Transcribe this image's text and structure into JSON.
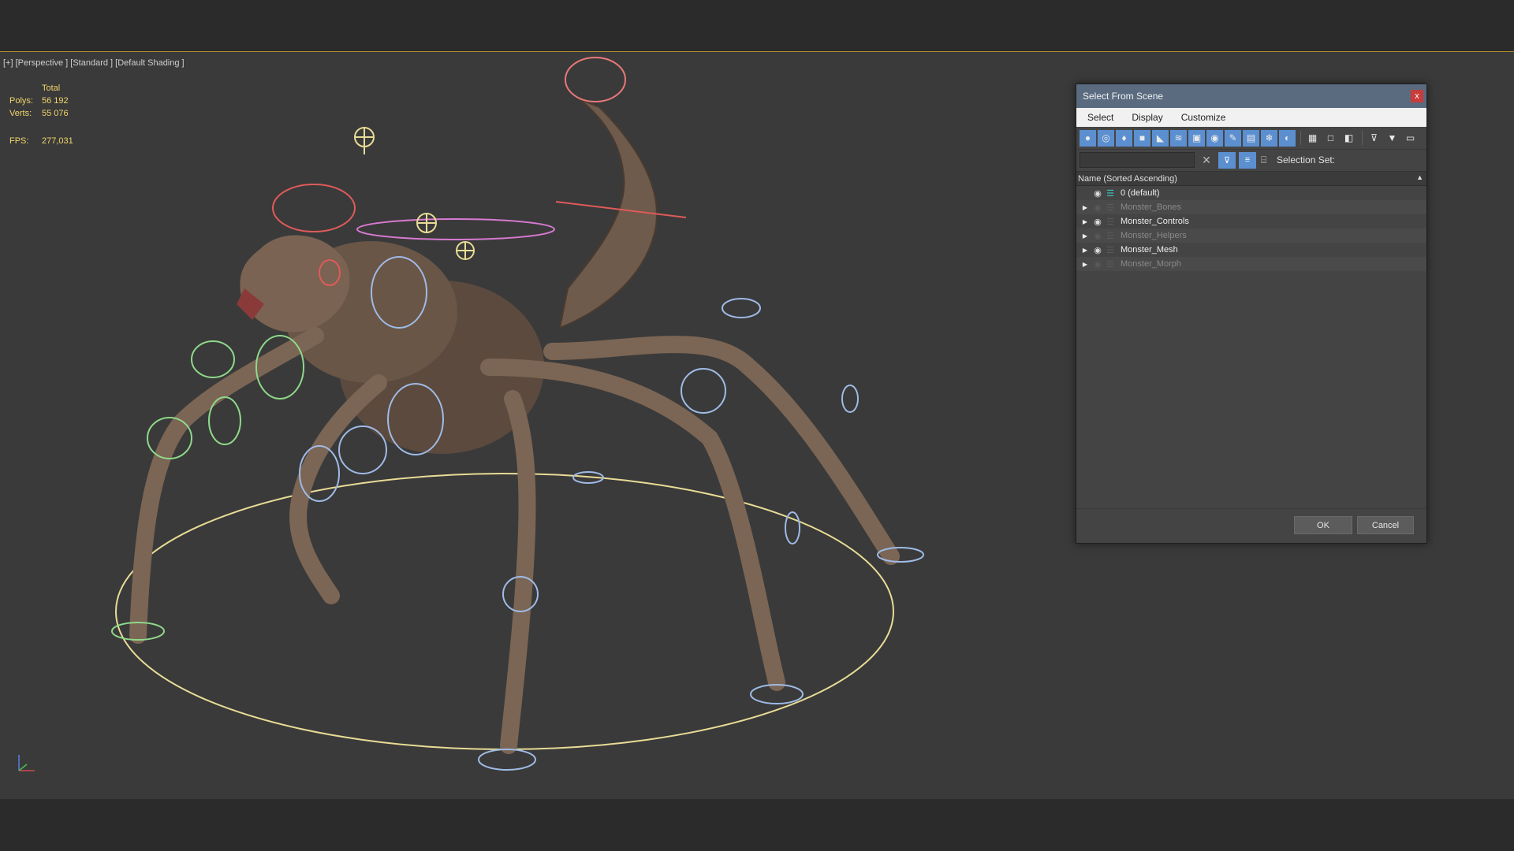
{
  "viewport": {
    "label": "[+] [Perspective ] [Standard ] [Default Shading ]",
    "stats": {
      "total_label": "Total",
      "polys_label": "Polys:",
      "polys_value": "56 192",
      "verts_label": "Verts:",
      "verts_value": "55 076",
      "fps_label": "FPS:",
      "fps_value": "277,031"
    }
  },
  "dialog": {
    "title": "Select From Scene",
    "close": "x",
    "menu": [
      "Select",
      "Display",
      "Customize"
    ],
    "toolbar_icons": [
      "geometry-filter-icon",
      "shapes-filter-icon",
      "lights-filter-icon",
      "cameras-filter-icon",
      "helpers-filter-icon",
      "space-warps-filter-icon",
      "groups-filter-icon",
      "xrefs-filter-icon",
      "bones-filter-icon",
      "containers-filter-icon",
      "frozen-filter-icon",
      "hidden-filter-icon",
      "display-all-icon",
      "display-none-icon",
      "invert-display-icon",
      "find-case-icon",
      "filter-icon",
      "sync-selection-icon"
    ],
    "search_value": "",
    "selection_set_label": "Selection Set:",
    "list_header": "Name (Sorted Ascending)",
    "rows": [
      {
        "name": "0 (default)",
        "expandable": false,
        "visible": true
      },
      {
        "name": "Monster_Bones",
        "expandable": true,
        "visible": false
      },
      {
        "name": "Monster_Controls",
        "expandable": true,
        "visible": true
      },
      {
        "name": "Monster_Helpers",
        "expandable": true,
        "visible": false
      },
      {
        "name": "Monster_Mesh",
        "expandable": true,
        "visible": true
      },
      {
        "name": "Monster_Morph",
        "expandable": true,
        "visible": false
      }
    ],
    "ok_label": "OK",
    "cancel_label": "Cancel"
  }
}
